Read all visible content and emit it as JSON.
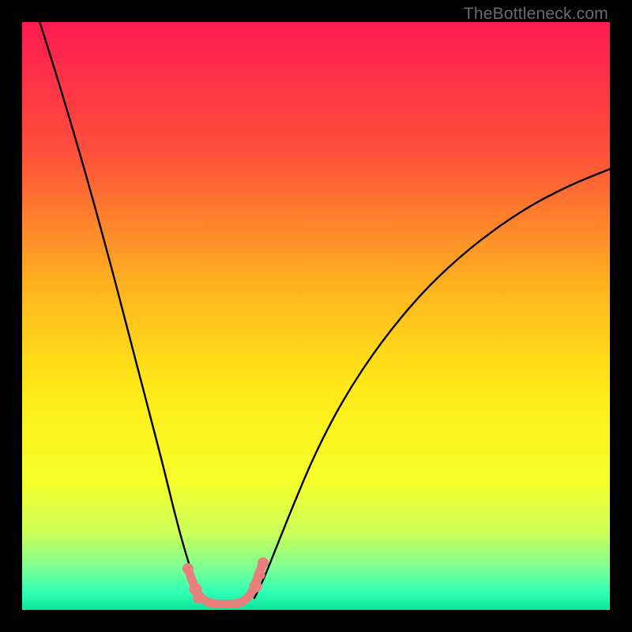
{
  "watermark": "TheBottleneck.com",
  "chart_data": {
    "type": "line",
    "title": "",
    "xlabel": "",
    "ylabel": "",
    "xlim": [
      0,
      1
    ],
    "ylim": [
      0,
      1
    ],
    "gradient_stops": [
      {
        "pos": 0.0,
        "color": "#ff1a52"
      },
      {
        "pos": 0.22,
        "color": "#ff4f3a"
      },
      {
        "pos": 0.45,
        "color": "#ffb31f"
      },
      {
        "pos": 0.62,
        "color": "#ffe917"
      },
      {
        "pos": 0.78,
        "color": "#f6ff28"
      },
      {
        "pos": 0.87,
        "color": "#c9ff5a"
      },
      {
        "pos": 0.93,
        "color": "#7bff95"
      },
      {
        "pos": 0.97,
        "color": "#2fffb6"
      },
      {
        "pos": 1.0,
        "color": "#09e59a"
      }
    ],
    "series": [
      {
        "name": "left-branch",
        "description": "Steep descending curve from top-left toward valley floor",
        "x": [
          0.03,
          0.06,
          0.09,
          0.12,
          0.15,
          0.18,
          0.21,
          0.24,
          0.262,
          0.28,
          0.295,
          0.305
        ],
        "y": [
          1.0,
          0.905,
          0.805,
          0.7,
          0.59,
          0.475,
          0.36,
          0.245,
          0.155,
          0.09,
          0.045,
          0.02
        ]
      },
      {
        "name": "right-branch",
        "description": "Rising curve from valley floor toward upper-right, flattening",
        "x": [
          0.395,
          0.41,
          0.43,
          0.46,
          0.5,
          0.55,
          0.61,
          0.68,
          0.76,
          0.85,
          0.93,
          1.0
        ],
        "y": [
          0.02,
          0.05,
          0.1,
          0.175,
          0.27,
          0.365,
          0.455,
          0.54,
          0.615,
          0.68,
          0.722,
          0.75
        ]
      },
      {
        "name": "valley-floor",
        "description": "Short salmon-colored segment with dots at the valley bottom",
        "x": [
          0.282,
          0.293,
          0.3,
          0.315,
          0.335,
          0.355,
          0.375,
          0.392,
          0.4,
          0.408
        ],
        "y": [
          0.07,
          0.04,
          0.025,
          0.012,
          0.01,
          0.01,
          0.012,
          0.03,
          0.055,
          0.075
        ],
        "color": "#e77f7c"
      }
    ],
    "markers": [
      {
        "x": 0.282,
        "y": 0.07,
        "r": 7,
        "color": "#e77f7c"
      },
      {
        "x": 0.295,
        "y": 0.035,
        "r": 8,
        "color": "#e77f7c"
      },
      {
        "x": 0.3,
        "y": 0.02,
        "r": 7,
        "color": "#e77f7c"
      },
      {
        "x": 0.397,
        "y": 0.04,
        "r": 8,
        "color": "#e77f7c"
      },
      {
        "x": 0.404,
        "y": 0.06,
        "r": 7,
        "color": "#e77f7c"
      },
      {
        "x": 0.41,
        "y": 0.08,
        "r": 7,
        "color": "#e77f7c"
      }
    ]
  }
}
